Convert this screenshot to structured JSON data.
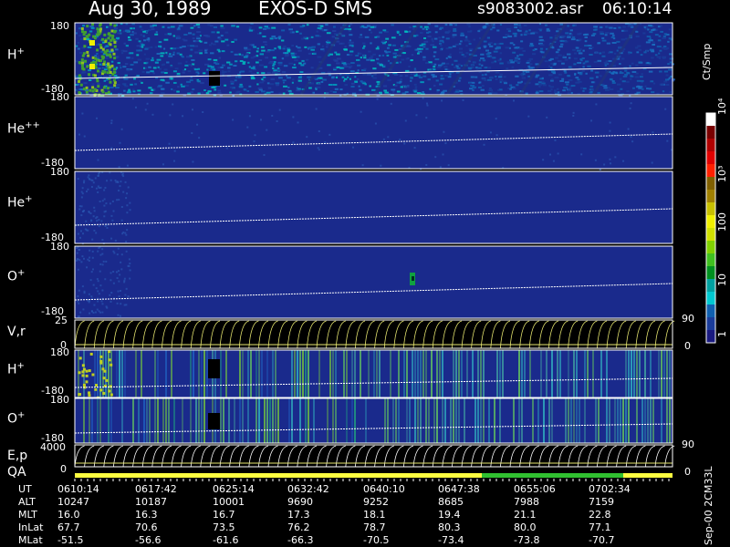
{
  "header": {
    "date": "Aug 30, 1989",
    "mission": "EXOS-D SMS",
    "file": "s9083002.asr",
    "time": "06:10:14"
  },
  "colorbar": {
    "label": "Ct/Smp",
    "ticks": [
      "10⁴",
      "10³",
      "100",
      "10",
      "1"
    ],
    "colors": [
      "#ffffff",
      "#7a0000",
      "#b00000",
      "#e00000",
      "#ff2000",
      "#806000",
      "#a08000",
      "#c8c000",
      "#f0f000",
      "#d0e000",
      "#80d000",
      "#40c020",
      "#009020",
      "#00a0a0",
      "#00c8d0",
      "#1060b0",
      "#1a3c9a",
      "#1a1a80"
    ]
  },
  "panels": [
    {
      "name": "h-plus-pitch",
      "label": "H",
      "sup": "+",
      "top": "180",
      "bottom": "-180"
    },
    {
      "name": "he-plusplus-pitch",
      "label": "He",
      "sup": "++",
      "top": "180",
      "bottom": "-180"
    },
    {
      "name": "he-plus-pitch",
      "label": "He",
      "sup": "+",
      "top": "180",
      "bottom": "-180"
    },
    {
      "name": "o-plus-pitch",
      "label": "O",
      "sup": "+",
      "top": "180",
      "bottom": "-180"
    },
    {
      "name": "velocity-panel",
      "label": "V,r",
      "top": "25",
      "bottom": "0",
      "right_top": "90",
      "right_bottom": "0"
    },
    {
      "name": "h-plus-energy",
      "label": "H",
      "sup": "+",
      "top": "180",
      "bottom": "-180"
    },
    {
      "name": "o-plus-energy",
      "label": "O",
      "sup": "+",
      "top": "180",
      "bottom": "-180"
    },
    {
      "name": "ep-panel",
      "label": "E,p",
      "top": "4000",
      "bottom": "0",
      "right_top": "90",
      "right_bottom": "0"
    }
  ],
  "qa_label": "QA",
  "side_label": "Sep-00  2CM33L",
  "table": {
    "rows": [
      {
        "key": "UT",
        "values": [
          "0610:14",
          "0617:42",
          "0625:14",
          "0632:42",
          "0640:10",
          "0647:38",
          "0655:06",
          "0702:34"
        ]
      },
      {
        "key": "ALT",
        "values": [
          "10247",
          "10187",
          "10001",
          "9690",
          "9252",
          "8685",
          "7988",
          "7159"
        ]
      },
      {
        "key": "MLT",
        "values": [
          "16.0",
          "16.3",
          "16.7",
          "17.3",
          "18.1",
          "19.4",
          "21.1",
          "22.8"
        ]
      },
      {
        "key": "InLat",
        "values": [
          "67.7",
          "70.6",
          "73.5",
          "76.2",
          "78.7",
          "80.3",
          "80.0",
          "77.1"
        ]
      },
      {
        "key": "MLat",
        "values": [
          "-51.5",
          "-56.6",
          "-61.6",
          "-66.3",
          "-70.5",
          "-73.4",
          "-73.8",
          "-70.7"
        ]
      }
    ]
  },
  "chart_data": {
    "type": "heatmap",
    "title": "Aug 30, 1989   EXOS-D SMS",
    "x_ticks": [
      "0610:14",
      "0617:42",
      "0625:14",
      "0632:42",
      "0640:10",
      "0647:38",
      "0655:06",
      "0702:34"
    ],
    "colorbar_scale": "log",
    "colorbar_range": [
      1,
      10000
    ],
    "colorbar_unit": "Ct/Smp",
    "panels": [
      "H+",
      "He++",
      "He+",
      "O+",
      "V,r",
      "H+",
      "O+",
      "E,p"
    ],
    "y_range_pitch": [
      -180,
      180
    ]
  }
}
